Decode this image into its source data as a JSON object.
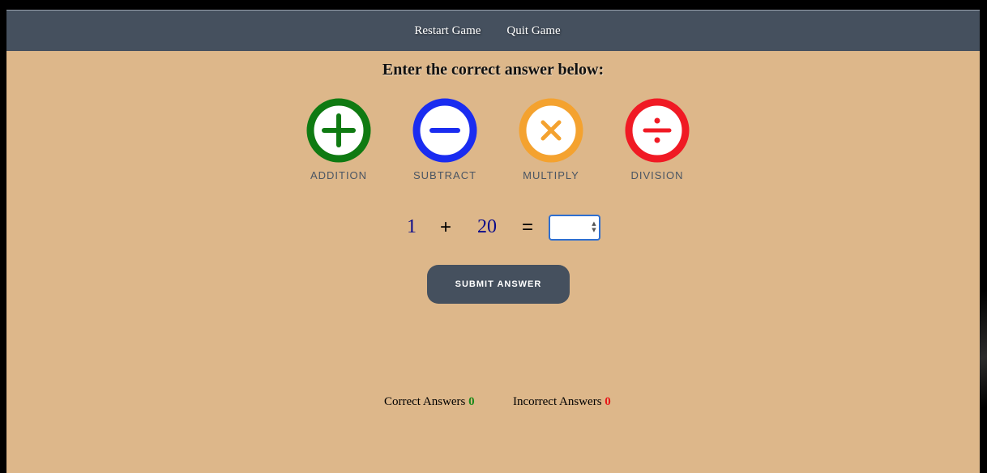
{
  "nav": {
    "restart_label": "Restart Game",
    "quit_label": "Quit Game"
  },
  "heading": "Enter the correct answer below:",
  "operations": [
    {
      "label": "ADDITION",
      "icon": "plus-icon",
      "color": "#0f7a12"
    },
    {
      "label": "SUBTRACT",
      "icon": "minus-icon",
      "color": "#1a2cf0"
    },
    {
      "label": "MULTIPLY",
      "icon": "times-icon",
      "color": "#f4a22f"
    },
    {
      "label": "DIVISION",
      "icon": "divide-icon",
      "color": "#f01a24"
    }
  ],
  "equation": {
    "operand1": "1",
    "operator": "+",
    "operand2": "20",
    "equals": "=",
    "answer_value": ""
  },
  "submit_label": "SUBMIT ANSWER",
  "scores": {
    "correct_label": "Correct Answers",
    "correct_value": "0",
    "incorrect_label": "Incorrect Answers",
    "incorrect_value": "0"
  },
  "colors": {
    "page_background": "#ddb78a",
    "header_background": "#45505e",
    "correct": "#1a8a1a",
    "incorrect": "#e81818"
  }
}
